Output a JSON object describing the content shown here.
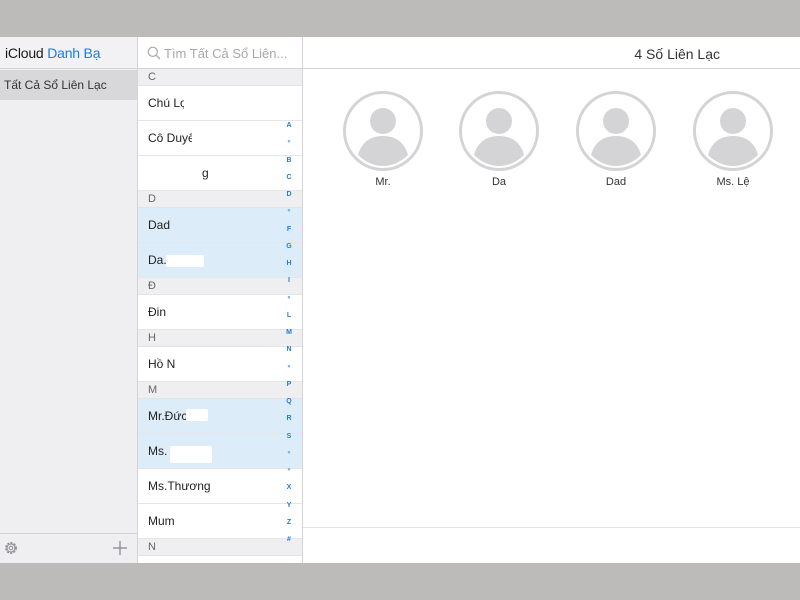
{
  "sidebar": {
    "title_plain": "iCloud",
    "title_accent": "Danh Bạ",
    "groups": [
      {
        "label": "Tất Cả Sổ Liên Lạc",
        "selected": true
      }
    ],
    "footer": {
      "settings_icon": "gear-icon",
      "add_icon": "plus-icon"
    }
  },
  "search": {
    "placeholder": "Tìm Tất Cả Sổ Liên...",
    "value": "",
    "icon": "search-icon"
  },
  "contact_list": {
    "sections": [
      {
        "letter": "C",
        "contacts": [
          {
            "name": "Chú Lợi",
            "selected": false
          },
          {
            "name": "Cô Duyên",
            "selected": false
          },
          {
            "name": "g",
            "selected": false
          }
        ]
      },
      {
        "letter": "D",
        "contacts": [
          {
            "name": "Dad",
            "selected": true
          },
          {
            "name": "Da...",
            "selected": true
          }
        ]
      },
      {
        "letter": "Đ",
        "contacts": [
          {
            "name": "Đin",
            "selected": false
          }
        ]
      },
      {
        "letter": "H",
        "contacts": [
          {
            "name": "Hồ N",
            "selected": false
          }
        ]
      },
      {
        "letter": "M",
        "contacts": [
          {
            "name": "Mr.Đức",
            "selected": true
          },
          {
            "name": "Ms.",
            "selected": true
          },
          {
            "name": "Ms.Thương",
            "selected": false
          },
          {
            "name": "Mum",
            "selected": false
          }
        ]
      },
      {
        "letter": "N",
        "contacts": []
      }
    ],
    "index": [
      "A",
      "•",
      "B",
      "C",
      "D",
      "•",
      "F",
      "G",
      "H",
      "I",
      "•",
      "L",
      "M",
      "N",
      "•",
      "P",
      "Q",
      "R",
      "S",
      "•",
      "•",
      "X",
      "Y",
      "Z",
      "#"
    ]
  },
  "detail": {
    "title": "4 Số Liên Lạc",
    "selected_contacts": [
      {
        "name": "Mr.",
        "avatar_icon": "person-silhouette-icon"
      },
      {
        "name": "Da",
        "avatar_icon": "person-silhouette-icon"
      },
      {
        "name": "Dad",
        "avatar_icon": "person-silhouette-icon"
      },
      {
        "name": "Ms. Lệ",
        "avatar_icon": "person-silhouette-icon"
      }
    ]
  },
  "colors": {
    "accent": "#1e7cdf",
    "selected_row": "#dcecf8",
    "sidebar_bg": "#efeff1",
    "avatar_gray": "#d4d4d7"
  }
}
